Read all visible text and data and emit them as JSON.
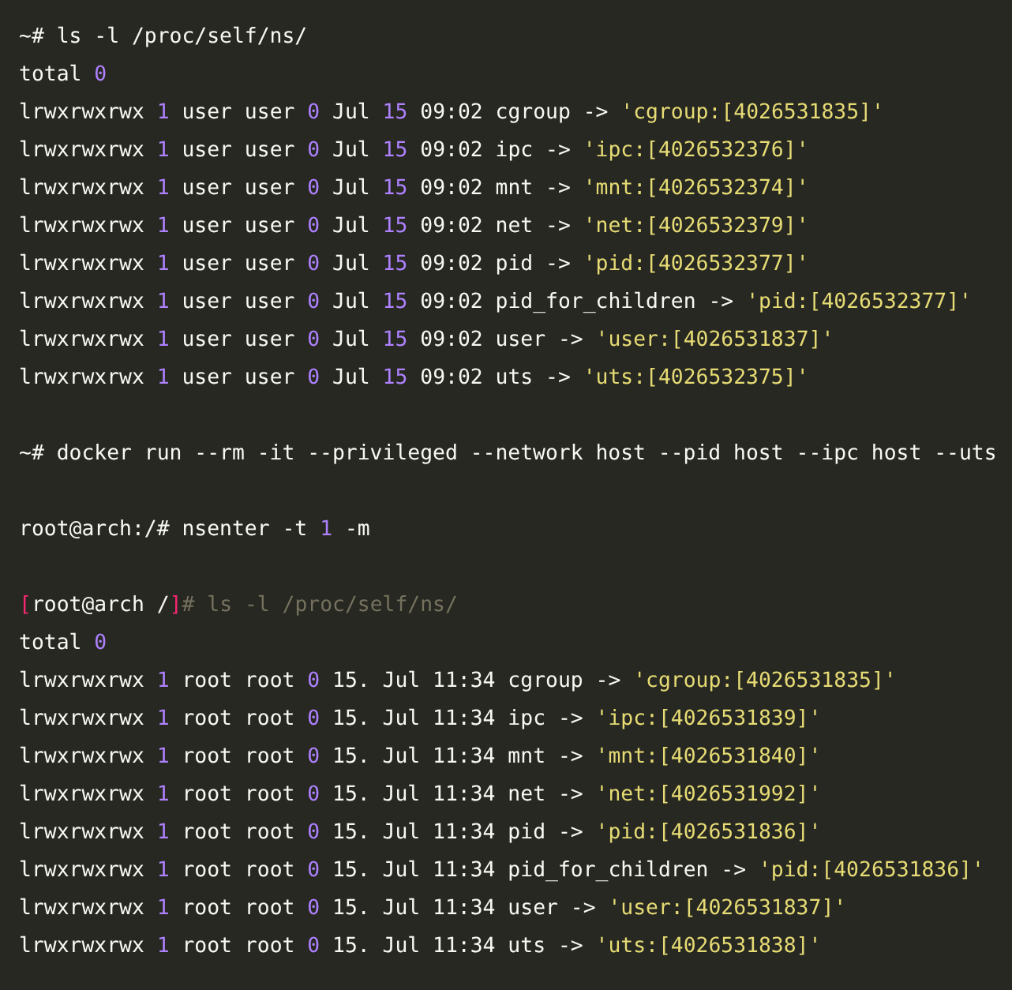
{
  "code_block": {
    "lines": [
      {
        "kind": "code",
        "tokens": [
          {
            "kind": "plain",
            "text": "~# ls -l /proc/self/ns/"
          }
        ]
      },
      {
        "kind": "code",
        "tokens": [
          {
            "kind": "plain",
            "text": "total "
          },
          {
            "kind": "number",
            "text": "0"
          }
        ]
      },
      {
        "kind": "code",
        "tokens": [
          {
            "kind": "plain",
            "text": "lrwxrwxrwx "
          },
          {
            "kind": "number",
            "text": "1"
          },
          {
            "kind": "plain",
            "text": " user user "
          },
          {
            "kind": "number",
            "text": "0"
          },
          {
            "kind": "plain",
            "text": " Jul "
          },
          {
            "kind": "number",
            "text": "15"
          },
          {
            "kind": "plain",
            "text": " 09:02 cgroup -> "
          },
          {
            "kind": "string",
            "text": "'cgroup:[4026531835]'"
          }
        ]
      },
      {
        "kind": "code",
        "tokens": [
          {
            "kind": "plain",
            "text": "lrwxrwxrwx "
          },
          {
            "kind": "number",
            "text": "1"
          },
          {
            "kind": "plain",
            "text": " user user "
          },
          {
            "kind": "number",
            "text": "0"
          },
          {
            "kind": "plain",
            "text": " Jul "
          },
          {
            "kind": "number",
            "text": "15"
          },
          {
            "kind": "plain",
            "text": " 09:02 ipc -> "
          },
          {
            "kind": "string",
            "text": "'ipc:[4026532376]'"
          }
        ]
      },
      {
        "kind": "code",
        "tokens": [
          {
            "kind": "plain",
            "text": "lrwxrwxrwx "
          },
          {
            "kind": "number",
            "text": "1"
          },
          {
            "kind": "plain",
            "text": " user user "
          },
          {
            "kind": "number",
            "text": "0"
          },
          {
            "kind": "plain",
            "text": " Jul "
          },
          {
            "kind": "number",
            "text": "15"
          },
          {
            "kind": "plain",
            "text": " 09:02 mnt -> "
          },
          {
            "kind": "string",
            "text": "'mnt:[4026532374]'"
          }
        ]
      },
      {
        "kind": "code",
        "tokens": [
          {
            "kind": "plain",
            "text": "lrwxrwxrwx "
          },
          {
            "kind": "number",
            "text": "1"
          },
          {
            "kind": "plain",
            "text": " user user "
          },
          {
            "kind": "number",
            "text": "0"
          },
          {
            "kind": "plain",
            "text": " Jul "
          },
          {
            "kind": "number",
            "text": "15"
          },
          {
            "kind": "plain",
            "text": " 09:02 net -> "
          },
          {
            "kind": "string",
            "text": "'net:[4026532379]'"
          }
        ]
      },
      {
        "kind": "code",
        "tokens": [
          {
            "kind": "plain",
            "text": "lrwxrwxrwx "
          },
          {
            "kind": "number",
            "text": "1"
          },
          {
            "kind": "plain",
            "text": " user user "
          },
          {
            "kind": "number",
            "text": "0"
          },
          {
            "kind": "plain",
            "text": " Jul "
          },
          {
            "kind": "number",
            "text": "15"
          },
          {
            "kind": "plain",
            "text": " 09:02 pid -> "
          },
          {
            "kind": "string",
            "text": "'pid:[4026532377]'"
          }
        ]
      },
      {
        "kind": "code",
        "tokens": [
          {
            "kind": "plain",
            "text": "lrwxrwxrwx "
          },
          {
            "kind": "number",
            "text": "1"
          },
          {
            "kind": "plain",
            "text": " user user "
          },
          {
            "kind": "number",
            "text": "0"
          },
          {
            "kind": "plain",
            "text": " Jul "
          },
          {
            "kind": "number",
            "text": "15"
          },
          {
            "kind": "plain",
            "text": " 09:02 pid_for_children -> "
          },
          {
            "kind": "string",
            "text": "'pid:[4026532377]'"
          }
        ]
      },
      {
        "kind": "code",
        "tokens": [
          {
            "kind": "plain",
            "text": "lrwxrwxrwx "
          },
          {
            "kind": "number",
            "text": "1"
          },
          {
            "kind": "plain",
            "text": " user user "
          },
          {
            "kind": "number",
            "text": "0"
          },
          {
            "kind": "plain",
            "text": " Jul "
          },
          {
            "kind": "number",
            "text": "15"
          },
          {
            "kind": "plain",
            "text": " 09:02 user -> "
          },
          {
            "kind": "string",
            "text": "'user:[4026531837]'"
          }
        ]
      },
      {
        "kind": "code",
        "tokens": [
          {
            "kind": "plain",
            "text": "lrwxrwxrwx "
          },
          {
            "kind": "number",
            "text": "1"
          },
          {
            "kind": "plain",
            "text": " user user "
          },
          {
            "kind": "number",
            "text": "0"
          },
          {
            "kind": "plain",
            "text": " Jul "
          },
          {
            "kind": "number",
            "text": "15"
          },
          {
            "kind": "plain",
            "text": " 09:02 uts -> "
          },
          {
            "kind": "string",
            "text": "'uts:[4026532375]'"
          }
        ]
      },
      {
        "kind": "blank"
      },
      {
        "kind": "code",
        "tokens": [
          {
            "kind": "plain",
            "text": "~# docker run --rm -it --privileged --network host --pid host --ipc host --uts"
          }
        ]
      },
      {
        "kind": "blank"
      },
      {
        "kind": "code",
        "tokens": [
          {
            "kind": "plain",
            "text": "root@arch:/# nsenter -t "
          },
          {
            "kind": "number",
            "text": "1"
          },
          {
            "kind": "plain",
            "text": " -m"
          }
        ]
      },
      {
        "kind": "blank"
      },
      {
        "kind": "code",
        "tokens": [
          {
            "kind": "bracket",
            "text": "["
          },
          {
            "kind": "plain",
            "text": "root@arch /"
          },
          {
            "kind": "bracket",
            "text": "]"
          },
          {
            "kind": "comment",
            "text": "# ls -l /proc/self/ns/"
          }
        ]
      },
      {
        "kind": "code",
        "tokens": [
          {
            "kind": "plain",
            "text": "total "
          },
          {
            "kind": "number",
            "text": "0"
          }
        ]
      },
      {
        "kind": "code",
        "tokens": [
          {
            "kind": "plain",
            "text": "lrwxrwxrwx "
          },
          {
            "kind": "number",
            "text": "1"
          },
          {
            "kind": "plain",
            "text": " root root "
          },
          {
            "kind": "number",
            "text": "0"
          },
          {
            "kind": "plain",
            "text": " 15. Jul 11:34 cgroup -> "
          },
          {
            "kind": "string",
            "text": "'cgroup:[4026531835]'"
          }
        ]
      },
      {
        "kind": "code",
        "tokens": [
          {
            "kind": "plain",
            "text": "lrwxrwxrwx "
          },
          {
            "kind": "number",
            "text": "1"
          },
          {
            "kind": "plain",
            "text": " root root "
          },
          {
            "kind": "number",
            "text": "0"
          },
          {
            "kind": "plain",
            "text": " 15. Jul 11:34 ipc -> "
          },
          {
            "kind": "string",
            "text": "'ipc:[4026531839]'"
          }
        ]
      },
      {
        "kind": "code",
        "tokens": [
          {
            "kind": "plain",
            "text": "lrwxrwxrwx "
          },
          {
            "kind": "number",
            "text": "1"
          },
          {
            "kind": "plain",
            "text": " root root "
          },
          {
            "kind": "number",
            "text": "0"
          },
          {
            "kind": "plain",
            "text": " 15. Jul 11:34 mnt -> "
          },
          {
            "kind": "string",
            "text": "'mnt:[4026531840]'"
          }
        ]
      },
      {
        "kind": "code",
        "tokens": [
          {
            "kind": "plain",
            "text": "lrwxrwxrwx "
          },
          {
            "kind": "number",
            "text": "1"
          },
          {
            "kind": "plain",
            "text": " root root "
          },
          {
            "kind": "number",
            "text": "0"
          },
          {
            "kind": "plain",
            "text": " 15. Jul 11:34 net -> "
          },
          {
            "kind": "string",
            "text": "'net:[4026531992]'"
          }
        ]
      },
      {
        "kind": "code",
        "tokens": [
          {
            "kind": "plain",
            "text": "lrwxrwxrwx "
          },
          {
            "kind": "number",
            "text": "1"
          },
          {
            "kind": "plain",
            "text": " root root "
          },
          {
            "kind": "number",
            "text": "0"
          },
          {
            "kind": "plain",
            "text": " 15. Jul 11:34 pid -> "
          },
          {
            "kind": "string",
            "text": "'pid:[4026531836]'"
          }
        ]
      },
      {
        "kind": "code",
        "tokens": [
          {
            "kind": "plain",
            "text": "lrwxrwxrwx "
          },
          {
            "kind": "number",
            "text": "1"
          },
          {
            "kind": "plain",
            "text": " root root "
          },
          {
            "kind": "number",
            "text": "0"
          },
          {
            "kind": "plain",
            "text": " 15. Jul 11:34 pid_for_children -> "
          },
          {
            "kind": "string",
            "text": "'pid:[4026531836]'"
          }
        ]
      },
      {
        "kind": "code",
        "tokens": [
          {
            "kind": "plain",
            "text": "lrwxrwxrwx "
          },
          {
            "kind": "number",
            "text": "1"
          },
          {
            "kind": "plain",
            "text": " root root "
          },
          {
            "kind": "number",
            "text": "0"
          },
          {
            "kind": "plain",
            "text": " 15. Jul 11:34 user -> "
          },
          {
            "kind": "string",
            "text": "'user:[4026531837]'"
          }
        ]
      },
      {
        "kind": "code",
        "tokens": [
          {
            "kind": "plain",
            "text": "lrwxrwxrwx "
          },
          {
            "kind": "number",
            "text": "1"
          },
          {
            "kind": "plain",
            "text": " root root "
          },
          {
            "kind": "number",
            "text": "0"
          },
          {
            "kind": "plain",
            "text": " 15. Jul 11:34 uts -> "
          },
          {
            "kind": "string",
            "text": "'uts:[4026531838]'"
          }
        ]
      }
    ]
  }
}
